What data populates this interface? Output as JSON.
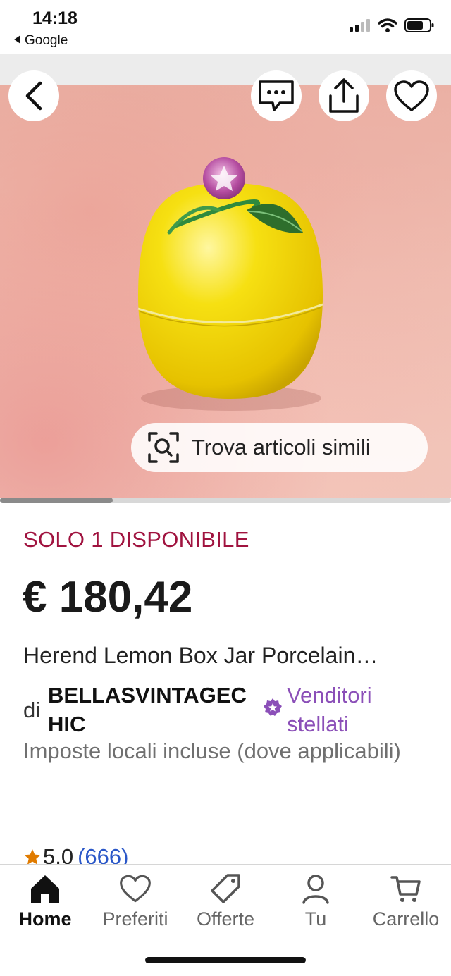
{
  "status_bar": {
    "time": "14:18",
    "back_app": "Google",
    "icons": [
      "cellular-signal-icon",
      "wifi-icon",
      "battery-icon"
    ]
  },
  "image_view": {
    "top_buttons": [
      "back-arrow-icon",
      "chat-icon",
      "share-icon",
      "heart-icon"
    ],
    "find_similar_label": "Trova articoli simili",
    "find_similar_icon": "visual-search-icon",
    "scroll_progress": 0.25
  },
  "listing": {
    "availability": "SOLO 1 DISPONIBILE",
    "price": "€ 180,42",
    "title": "Herend Lemon Box Jar Porcelain…",
    "seller_prefix": "di",
    "seller_name": "BELLASVINTAGECHIC",
    "seller_badge_icon": "star-seller-badge-icon",
    "seller_badge_label": "Venditori stellati",
    "taxes_note": "Imposte locali incluse (dove applicabili)",
    "rating_value": "5,0",
    "rating_count": "(666)"
  },
  "tab_bar": {
    "items": [
      {
        "label": "Home",
        "icon": "home-icon",
        "active": true
      },
      {
        "label": "Preferiti",
        "icon": "heart-icon",
        "active": false
      },
      {
        "label": "Offerte",
        "icon": "tag-icon",
        "active": false
      },
      {
        "label": "Tu",
        "icon": "person-icon",
        "active": false
      },
      {
        "label": "Carrello",
        "icon": "cart-icon",
        "active": false
      }
    ]
  },
  "colors": {
    "availability": "#a0133f",
    "seller_link": "#8b4fb8",
    "rating_count": "#2a57c8",
    "star": "#e07b00",
    "lemon": "#f2d400"
  }
}
